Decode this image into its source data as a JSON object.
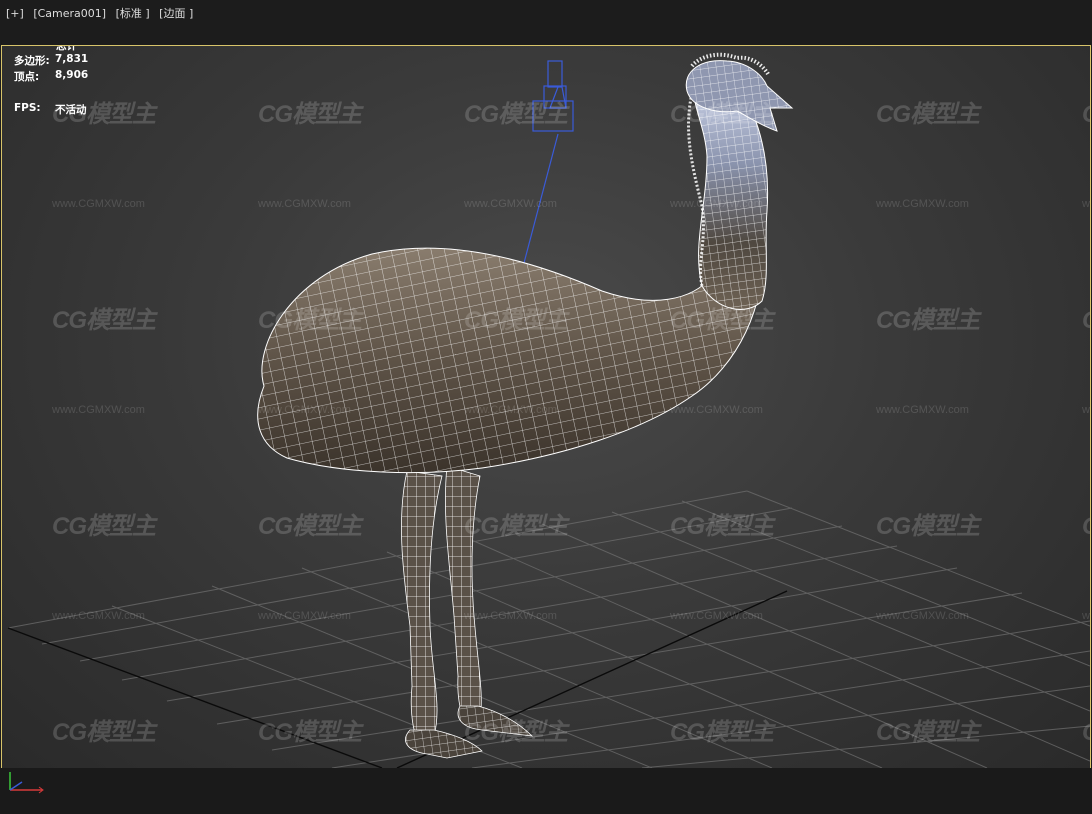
{
  "viewport_label": {
    "plus": "[+]",
    "camera": "[Camera001]",
    "shading": "[标准 ]",
    "mode": "[边面 ]"
  },
  "stats": {
    "header": "总计",
    "polygons_label": "多边形:",
    "polygons_value": "7,831",
    "vertices_label": "顶点:",
    "vertices_value": "8,906",
    "fps_label": "FPS:",
    "fps_value": "不活动"
  },
  "watermark": {
    "logo_text": "CG模型主",
    "url_text": "www.CGMXW.com"
  },
  "colors": {
    "viewport_border": "#d8c46a",
    "grid": "#6e6e6e",
    "wire": "#ffffff",
    "camera": "#3a5bd8"
  },
  "icons": {
    "camera_object": "camera-icon",
    "axis": "axis-tripod-icon"
  }
}
